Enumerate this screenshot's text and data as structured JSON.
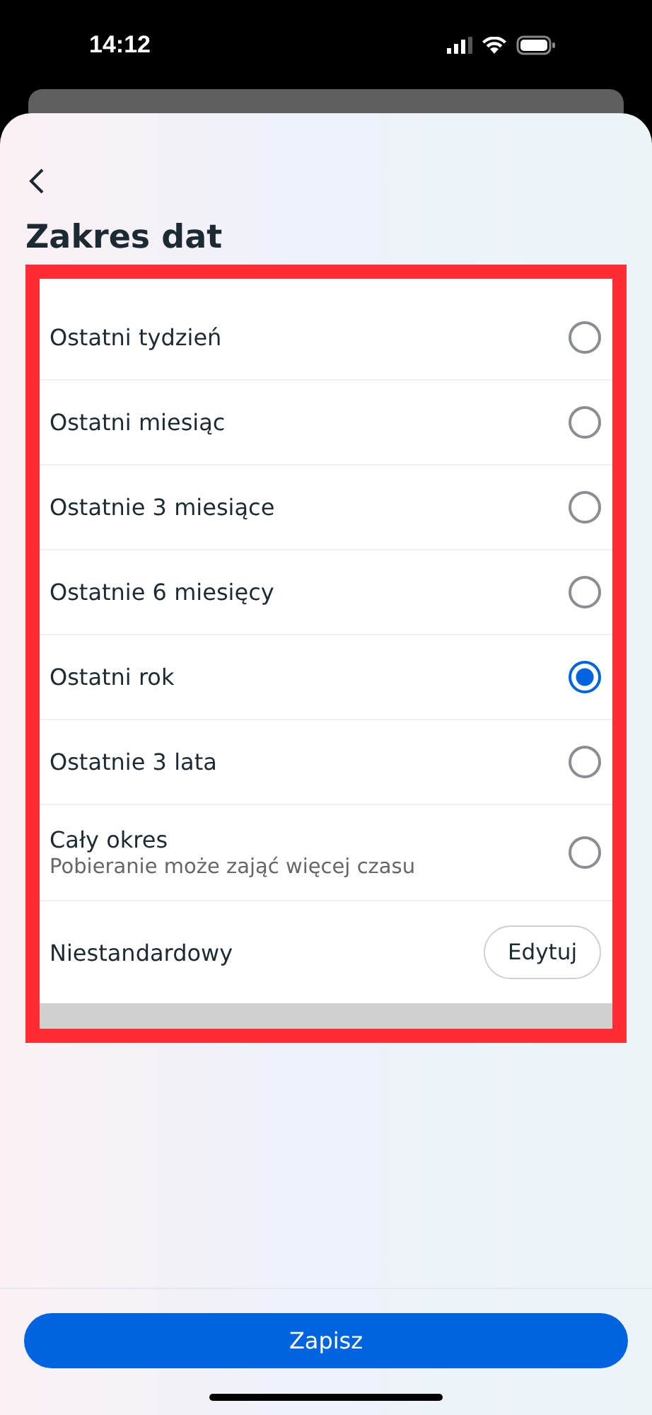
{
  "status_bar": {
    "time": "14:12"
  },
  "title": "Zakres dat",
  "options": [
    {
      "kind": "radio",
      "label": "Ostatni tydzień",
      "selected": false
    },
    {
      "kind": "radio",
      "label": "Ostatni miesiąc",
      "selected": false
    },
    {
      "kind": "radio",
      "label": "Ostatnie 3 miesiące",
      "selected": false
    },
    {
      "kind": "radio",
      "label": "Ostatnie 6 miesięcy",
      "selected": false
    },
    {
      "kind": "radio",
      "label": "Ostatni rok",
      "selected": true
    },
    {
      "kind": "radio",
      "label": "Ostatnie 3 lata",
      "selected": false
    },
    {
      "kind": "radio",
      "label": "Cały okres",
      "sublabel": "Pobieranie może zająć więcej czasu",
      "selected": false
    },
    {
      "kind": "button",
      "label": "Niestandardowy",
      "button": "Edytuj"
    }
  ],
  "save_button": "Zapisz"
}
